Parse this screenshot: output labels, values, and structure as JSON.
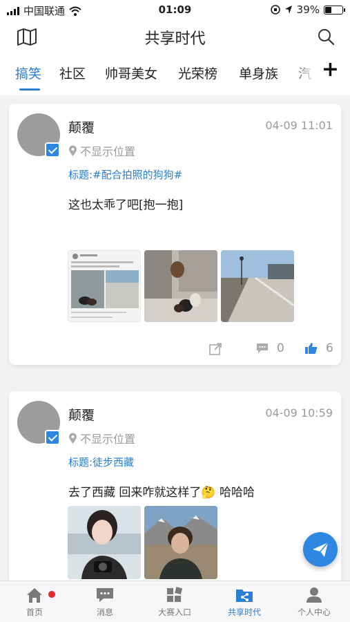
{
  "status_bar": {
    "carrier": "中国联通",
    "time": "01:09",
    "battery": "39%",
    "battery_level": 0.39
  },
  "header": {
    "title": "共享时代"
  },
  "tabs": [
    {
      "label": "搞笑",
      "active": true
    },
    {
      "label": "社区",
      "active": false
    },
    {
      "label": "帅哥美女",
      "active": false
    },
    {
      "label": "光荣榜",
      "active": false
    },
    {
      "label": "单身族",
      "active": false
    },
    {
      "label": "汽",
      "active": false
    }
  ],
  "tab_add": "+",
  "posts": [
    {
      "username": "颠覆",
      "time": "04-09 11:01",
      "location": "不显示位置",
      "title": "标题:#配合拍照的狗狗#",
      "text": "这也太乖了吧[抱一抱]",
      "comments": "0",
      "likes": "6"
    },
    {
      "username": "颠覆",
      "time": "04-09 10:59",
      "location": "不显示位置",
      "title": "标题:徒步西藏",
      "text": "去了西藏 回来咋就这样了🤔 哈哈哈"
    }
  ],
  "bottom_nav": [
    {
      "label": "首页",
      "active": false,
      "badge": true
    },
    {
      "label": "消息",
      "active": false
    },
    {
      "label": "大赛入口",
      "active": false
    },
    {
      "label": "共享时代",
      "active": true
    },
    {
      "label": "个人中心",
      "active": false
    }
  ],
  "colors": {
    "accent": "#2a7fd4",
    "badge": "#e5292e"
  }
}
